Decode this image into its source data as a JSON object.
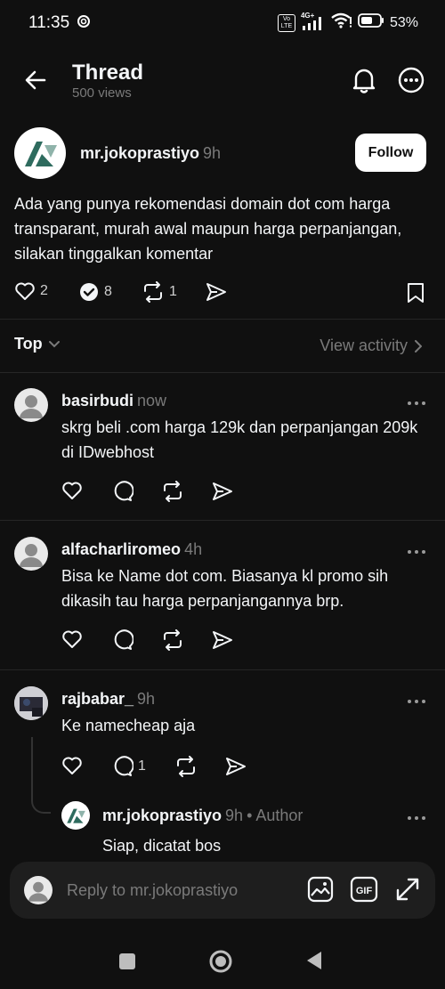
{
  "status": {
    "time": "11:35",
    "network": "4G+",
    "volte": "Vo LTE",
    "battery": "53%"
  },
  "header": {
    "title": "Thread",
    "subtitle": "500 views"
  },
  "post": {
    "username": "mr.jokoprastiyo",
    "time": "9h",
    "follow_label": "Follow",
    "text": "Ada yang punya rekomendasi domain dot com harga transparant, murah awal maupun harga perpanjangan, silakan tinggalkan komentar",
    "likes": "2",
    "replies": "8",
    "reposts": "1"
  },
  "sort": {
    "label": "Top",
    "activity": "View activity"
  },
  "replies": [
    {
      "username": "basirbudi",
      "time": "now",
      "text": "skrg beli .com harga 129k dan perpanjangan 209k di IDwebhost"
    },
    {
      "username": "alfacharliromeo",
      "time": "4h",
      "text": "Bisa ke Name dot com. Biasanya kl promo sih dikasih tau harga perpanjangannya brp."
    },
    {
      "username": "rajbabar_",
      "time": "9h",
      "text": "Ke namecheap aja",
      "reply_count": "1"
    }
  ],
  "nested": {
    "username": "mr.jokoprastiyo",
    "time": "9h",
    "author": "• Author",
    "text": "Siap, dicatat bos"
  },
  "composer": {
    "placeholder": "Reply to mr.jokoprastiyo"
  },
  "icons": [
    "back-arrow-icon",
    "bell-icon",
    "more-icon",
    "heart-icon",
    "comment-icon",
    "repost-icon",
    "share-icon",
    "bookmark-icon",
    "chevron-down-icon",
    "chevron-right-icon",
    "image-icon",
    "gif-icon",
    "expand-icon"
  ]
}
